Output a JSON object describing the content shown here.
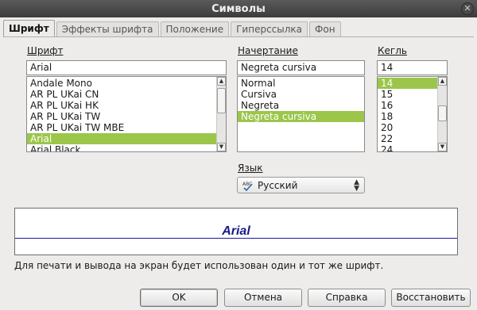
{
  "window": {
    "title": "Символы",
    "close_glyph": "✕"
  },
  "tabs": [
    {
      "label": "Шрифт",
      "active": true
    },
    {
      "label": "Эффекты шрифта",
      "active": false
    },
    {
      "label": "Положение",
      "active": false
    },
    {
      "label": "Гиперссылка",
      "active": false
    },
    {
      "label": "Фон",
      "active": false
    }
  ],
  "font": {
    "label": "Шрифт",
    "value": "Arial",
    "items": [
      "Andale Mono",
      "AR PL UKai CN",
      "AR PL UKai HK",
      "AR PL UKai TW",
      "AR PL UKai TW MBE",
      "Arial",
      "Arial Black"
    ],
    "selected": "Arial"
  },
  "style": {
    "label": "Начертание",
    "value": "Negreta cursiva",
    "items": [
      "Normal",
      "Cursiva",
      "Negreta",
      "Negreta cursiva"
    ],
    "selected": "Negreta cursiva"
  },
  "size": {
    "label": "Кегль",
    "value": "14",
    "items": [
      "14",
      "15",
      "16",
      "18",
      "20",
      "22",
      "24"
    ],
    "selected": "14"
  },
  "language": {
    "label": "Язык",
    "value": "Русский",
    "icon": "spellcheck-icon"
  },
  "preview": {
    "text": "Arial"
  },
  "note": "Для печати и вывода на экран будет использован один и тот же шрифт.",
  "buttons": {
    "ok": "OK",
    "cancel": "Отмена",
    "help": "Справка",
    "reset": "Восстановить"
  },
  "colors": {
    "selection": "#9bc64a",
    "preview_text": "#1a1a8a"
  }
}
